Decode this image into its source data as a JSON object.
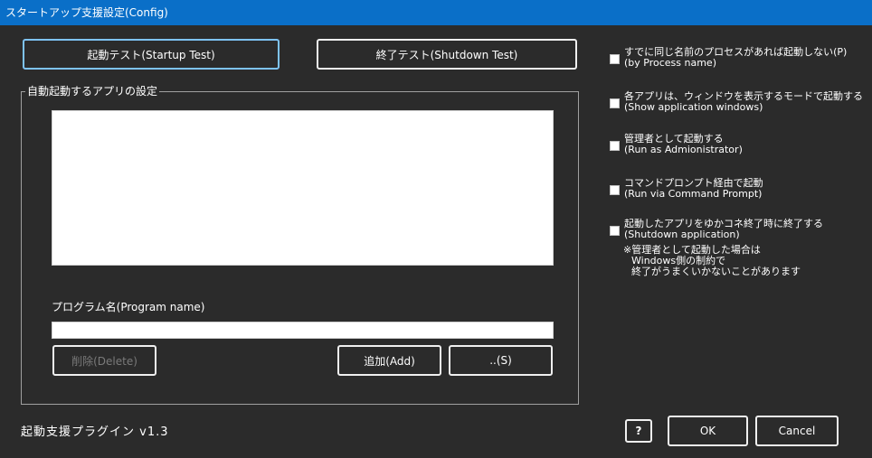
{
  "window": {
    "title": "スタートアップ支援設定(Config)"
  },
  "top_buttons": {
    "startup_test": "起動テスト(Startup Test)",
    "shutdown_test": "終了テスト(Shutdown Test)"
  },
  "group": {
    "title": "自動起動するアプリの設定",
    "program_label": "プログラム名(Program name)",
    "program_value": "",
    "delete_label": "削除(Delete)",
    "add_label": "追加(Add)",
    "browse_label": "..(S)"
  },
  "options": [
    {
      "line1": "すでに同じ名前のプロセスがあれば起動しない(P)",
      "line2": "(by Process name)",
      "checked": false
    },
    {
      "line1": "各アプリは、ウィンドウを表示するモードで起動する",
      "line2": "(Show application windows)",
      "checked": false
    },
    {
      "line1": "管理者として起動する",
      "line2": "(Run as Admionistrator)",
      "checked": false
    },
    {
      "line1": "コマンドプロンプト経由で起動",
      "line2": "(Run via Command Prompt)",
      "checked": false
    },
    {
      "line1": "起動したアプリをゆかコネ終了時に終了する",
      "line2": "(Shutdown application)",
      "checked": false
    }
  ],
  "note": {
    "line1": "※管理者として起動した場合は",
    "line2": "Windows側の制約で",
    "line3": "終了がうまくいかないことがあります"
  },
  "footer": {
    "version": "起動支援プラグイン v1.3",
    "help_label": "?",
    "ok_label": "OK",
    "cancel_label": "Cancel"
  },
  "colors": {
    "background": "#2b2b2b",
    "titlebar": "#0a6fc8",
    "focus_border": "#7ec3f5"
  }
}
